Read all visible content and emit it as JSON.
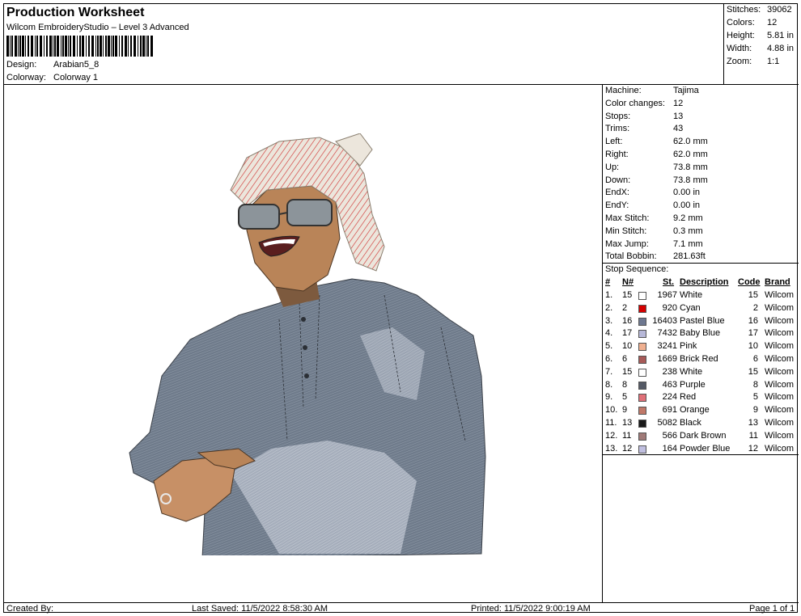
{
  "header": {
    "title": "Production Worksheet",
    "subtitle": "Wilcom EmbroideryStudio – Level 3 Advanced",
    "design_label": "Design:",
    "design_value": "Arabian5_8",
    "colorway_label": "Colorway:",
    "colorway_value": "Colorway 1"
  },
  "summary": {
    "stitches_label": "Stitches:",
    "stitches_value": "39062",
    "colors_label": "Colors:",
    "colors_value": "12",
    "height_label": "Height:",
    "height_value": "5.81 in",
    "width_label": "Width:",
    "width_value": "4.88 in",
    "zoom_label": "Zoom:",
    "zoom_value": "1:1"
  },
  "machine_info": [
    {
      "label": "Machine:",
      "value": "Tajima"
    },
    {
      "label": "Color changes:",
      "value": "12"
    },
    {
      "label": "Stops:",
      "value": "13"
    },
    {
      "label": "Trims:",
      "value": "43"
    },
    {
      "label": "Left:",
      "value": "62.0 mm"
    },
    {
      "label": "Right:",
      "value": "62.0 mm"
    },
    {
      "label": "Up:",
      "value": "73.8 mm"
    },
    {
      "label": "Down:",
      "value": "73.8 mm"
    },
    {
      "label": "EndX:",
      "value": "0.00 in"
    },
    {
      "label": "EndY:",
      "value": "0.00 in"
    },
    {
      "label": "Max Stitch:",
      "value": "9.2 mm"
    },
    {
      "label": "Min Stitch:",
      "value": "0.3 mm"
    },
    {
      "label": "Max Jump:",
      "value": "7.1 mm"
    },
    {
      "label": "Total Bobbin:",
      "value": "281.63ft"
    }
  ],
  "stop_sequence": {
    "title": "Stop Sequence:",
    "headers": {
      "num": "#",
      "n": "N#",
      "st": "St.",
      "desc": "Description",
      "code": "Code",
      "brand": "Brand"
    },
    "rows": [
      {
        "num": "1.",
        "n": "15",
        "color": "#ffffff",
        "st": "1967",
        "desc": "White",
        "code": "15",
        "brand": "Wilcom"
      },
      {
        "num": "2.",
        "n": "2",
        "color": "#d40000",
        "st": "920",
        "desc": "Cyan",
        "code": "2",
        "brand": "Wilcom"
      },
      {
        "num": "3.",
        "n": "16",
        "color": "#6e7890",
        "st": "16403",
        "desc": "Pastel Blue",
        "code": "16",
        "brand": "Wilcom"
      },
      {
        "num": "4.",
        "n": "17",
        "color": "#b7b8d8",
        "st": "7432",
        "desc": "Baby Blue",
        "code": "17",
        "brand": "Wilcom"
      },
      {
        "num": "5.",
        "n": "10",
        "color": "#f0b090",
        "st": "3241",
        "desc": "Pink",
        "code": "10",
        "brand": "Wilcom"
      },
      {
        "num": "6.",
        "n": "6",
        "color": "#a85a58",
        "st": "1669",
        "desc": "Brick Red",
        "code": "6",
        "brand": "Wilcom"
      },
      {
        "num": "7.",
        "n": "15",
        "color": "#ffffff",
        "st": "238",
        "desc": "White",
        "code": "15",
        "brand": "Wilcom"
      },
      {
        "num": "8.",
        "n": "8",
        "color": "#555a66",
        "st": "463",
        "desc": "Purple",
        "code": "8",
        "brand": "Wilcom"
      },
      {
        "num": "9.",
        "n": "5",
        "color": "#e07078",
        "st": "224",
        "desc": "Red",
        "code": "5",
        "brand": "Wilcom"
      },
      {
        "num": "10.",
        "n": "9",
        "color": "#c07868",
        "st": "691",
        "desc": "Orange",
        "code": "9",
        "brand": "Wilcom"
      },
      {
        "num": "11.",
        "n": "13",
        "color": "#1a1a1a",
        "st": "5082",
        "desc": "Black",
        "code": "13",
        "brand": "Wilcom"
      },
      {
        "num": "12.",
        "n": "11",
        "color": "#a07a78",
        "st": "566",
        "desc": "Dark Brown",
        "code": "11",
        "brand": "Wilcom"
      },
      {
        "num": "13.",
        "n": "12",
        "color": "#c0bfe0",
        "st": "164",
        "desc": "Powder Blue",
        "code": "12",
        "brand": "Wilcom"
      }
    ]
  },
  "footer": {
    "created_by": "Created By:",
    "last_saved": "Last Saved: 11/5/2022 8:58:30 AM",
    "printed": "Printed: 11/5/2022 9:00:19 AM",
    "page": "Page 1 of 1"
  }
}
